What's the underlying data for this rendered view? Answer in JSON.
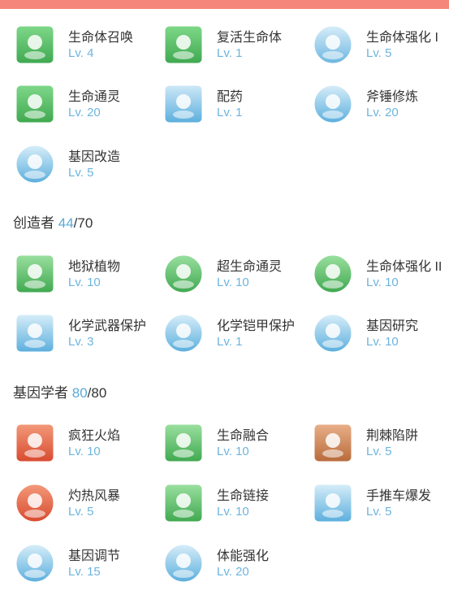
{
  "header": {
    "accent": "#f5867b"
  },
  "sections": [
    {
      "title": "创造者",
      "current": "44",
      "max": "70"
    },
    {
      "title": "基因学者",
      "current": "80",
      "max": "80"
    }
  ],
  "skills": [
    {
      "name": "生命体召唤",
      "level": "4",
      "icon": "summon-icon"
    },
    {
      "name": "复活生命体",
      "level": "1",
      "icon": "resurrect-icon"
    },
    {
      "name": "生命体强化 I",
      "level": "5",
      "icon": "enhance-icon"
    },
    {
      "name": "生命通灵",
      "level": "20",
      "icon": "spirit-icon"
    },
    {
      "name": "配药",
      "level": "1",
      "icon": "potion-icon"
    },
    {
      "name": "斧锤修炼",
      "level": "20",
      "icon": "axe-hammer-icon"
    },
    {
      "name": "基因改造",
      "level": "5",
      "icon": "dna-icon"
    },
    {
      "name": "地狱植物",
      "level": "10",
      "icon": "hell-plant-icon"
    },
    {
      "name": "超生命通灵",
      "level": "10",
      "icon": "super-spirit-icon"
    },
    {
      "name": "生命体强化 II",
      "level": "10",
      "icon": "enhance-2-icon"
    },
    {
      "name": "化学武器保护",
      "level": "3",
      "icon": "weapon-protect-icon"
    },
    {
      "name": "化学铠甲保护",
      "level": "1",
      "icon": "armor-protect-icon"
    },
    {
      "name": "基因研究",
      "level": "10",
      "icon": "gene-research-icon"
    },
    {
      "name": "疯狂火焰",
      "level": "10",
      "icon": "crazy-flame-icon"
    },
    {
      "name": "生命融合",
      "level": "10",
      "icon": "life-fusion-icon"
    },
    {
      "name": "荆棘陷阱",
      "level": "5",
      "icon": "thorn-trap-icon"
    },
    {
      "name": "灼热风暴",
      "level": "5",
      "icon": "fire-storm-icon"
    },
    {
      "name": "生命链接",
      "level": "10",
      "icon": "life-link-icon"
    },
    {
      "name": "手推车爆发",
      "level": "5",
      "icon": "cart-burst-icon"
    },
    {
      "name": "基因调节",
      "level": "15",
      "icon": "gene-regulate-icon"
    },
    {
      "name": "体能强化",
      "level": "20",
      "icon": "physical-boost-icon"
    }
  ],
  "level_prefix": "Lv. "
}
